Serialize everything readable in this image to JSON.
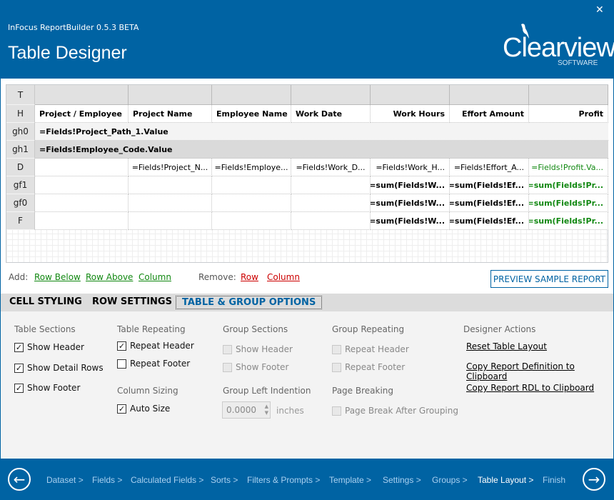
{
  "header": {
    "app_name": "InFocus ReportBuilder 0.5.3 BETA",
    "title": "Table Designer",
    "logo_text": "Clearview",
    "logo_sub": "SOFTWARE",
    "close_icon": "close-icon"
  },
  "grid": {
    "columns": [
      "Project / Employee",
      "Project Name",
      "Employee Name",
      "Work Date",
      "Work Hours",
      "Effort Amount",
      "Profit"
    ],
    "rows": [
      {
        "label": "T",
        "cells": [
          "",
          "",
          "",
          "",
          "",
          "",
          ""
        ]
      },
      {
        "label": "H",
        "cells": [
          "Project / Employee",
          "Project Name",
          "Employee Name",
          "Work Date",
          "Work Hours",
          "Effort Amount",
          "Profit"
        ]
      },
      {
        "label": "gh0",
        "span": "=Fields!Project_Path_1.Value"
      },
      {
        "label": "gh1",
        "span": "=Fields!Employee_Code.Value"
      },
      {
        "label": "D",
        "cells": [
          "",
          "=Fields!Project_N...",
          "=Fields!Employe...",
          "=Fields!Work_D...",
          "=Fields!Work_H...",
          "=Fields!Effort_A...",
          "=Fields!Profit.Va..."
        ]
      },
      {
        "label": "gf1",
        "cells": [
          "",
          "",
          "",
          "",
          "=sum(Fields!W...",
          "=sum(Fields!Ef...",
          "=sum(Fields!Pr..."
        ]
      },
      {
        "label": "gf0",
        "cells": [
          "",
          "",
          "",
          "",
          "=sum(Fields!W...",
          "=sum(Fields!Ef...",
          "=sum(Fields!Pr..."
        ]
      },
      {
        "label": "F",
        "cells": [
          "",
          "",
          "",
          "",
          "=sum(Fields!W...",
          "=sum(Fields!Ef...",
          "=sum(Fields!Pr..."
        ]
      }
    ],
    "profit_color": "#118811"
  },
  "toolbar": {
    "add_label": "Add:",
    "row_below": "Row Below",
    "row_above": "Row Above",
    "add_column": "Column",
    "remove_label": "Remove:",
    "remove_row": "Row",
    "remove_column": "Column",
    "preview": "PREVIEW SAMPLE REPORT",
    "add_color": "#118811",
    "remove_color": "#cc0000"
  },
  "tabs": [
    {
      "label": "CELL STYLING",
      "active": false
    },
    {
      "label": "ROW SETTINGS",
      "active": false
    },
    {
      "label": "TABLE & GROUP OPTIONS",
      "active": true
    }
  ],
  "options": {
    "table_sections": {
      "title": "Table Sections",
      "items": [
        {
          "label": "Show Header",
          "checked": true
        },
        {
          "label": "Show Detail Rows",
          "checked": true
        },
        {
          "label": "Show Footer",
          "checked": true
        }
      ]
    },
    "table_repeating": {
      "title": "Table Repeating",
      "items": [
        {
          "label": "Repeat Header",
          "checked": true
        },
        {
          "label": "Repeat Footer",
          "checked": false
        }
      ]
    },
    "column_sizing": {
      "title": "Column Sizing",
      "items": [
        {
          "label": "Auto Size",
          "checked": true
        }
      ]
    },
    "group_sections": {
      "title": "Group Sections",
      "items": [
        {
          "label": "Show Header",
          "checked": false,
          "disabled": true
        },
        {
          "label": "Show Footer",
          "checked": false,
          "disabled": true
        }
      ]
    },
    "group_indent": {
      "title": "Group Left Indention",
      "value": "0.0000",
      "unit": "inches"
    },
    "group_repeating": {
      "title": "Group Repeating",
      "items": [
        {
          "label": "Repeat Header",
          "checked": false,
          "disabled": true
        },
        {
          "label": "Repeat Footer",
          "checked": false,
          "disabled": true
        }
      ]
    },
    "page_breaking": {
      "title": "Page Breaking",
      "items": [
        {
          "label": "Page Break After Grouping",
          "checked": false,
          "disabled": true
        }
      ]
    },
    "designer_actions": {
      "title": "Designer Actions",
      "links": [
        "Reset Table Layout",
        "Copy Report Definition to Clipboard",
        "Copy Report RDL to Clipboard"
      ]
    }
  },
  "footer": {
    "steps": [
      "Dataset >",
      "Fields >",
      "Calculated Fields >",
      "Sorts >",
      "Filters & Prompts >",
      "Template >",
      "Settings >",
      "Groups >",
      "Table Layout >",
      "Finish"
    ],
    "current": "Table Layout >",
    "back_icon": "arrow-left-circle-icon",
    "next_icon": "arrow-right-circle-icon"
  }
}
